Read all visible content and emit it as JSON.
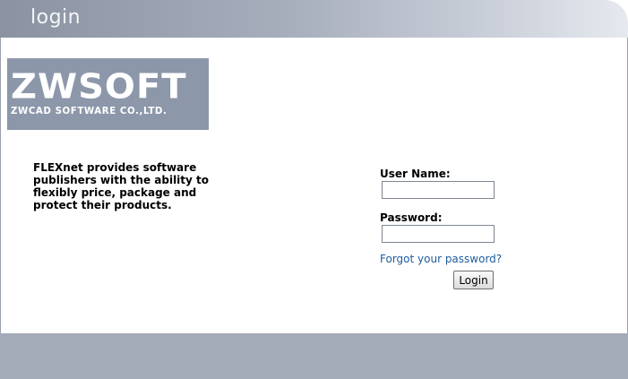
{
  "header": {
    "title": "login"
  },
  "logo": {
    "main_text_a": "ZW",
    "main_text_b": "SOFT",
    "sub_text": "ZWCAD SOFTWARE CO.,LTD."
  },
  "description": "FLEXnet provides software publishers with the ability to flexibly price, package and protect their products.",
  "form": {
    "username_label": "User Name:",
    "username_value": "",
    "password_label": "Password:",
    "password_value": "",
    "forgot_link": "Forgot your password?",
    "login_button": "Login"
  },
  "colors": {
    "header_gradient_start": "#8b93a2",
    "header_gradient_end": "#e6e9ef",
    "footer": "#a4abb8",
    "logo_background": "#8c97aa",
    "link": "#1f5c9e"
  }
}
